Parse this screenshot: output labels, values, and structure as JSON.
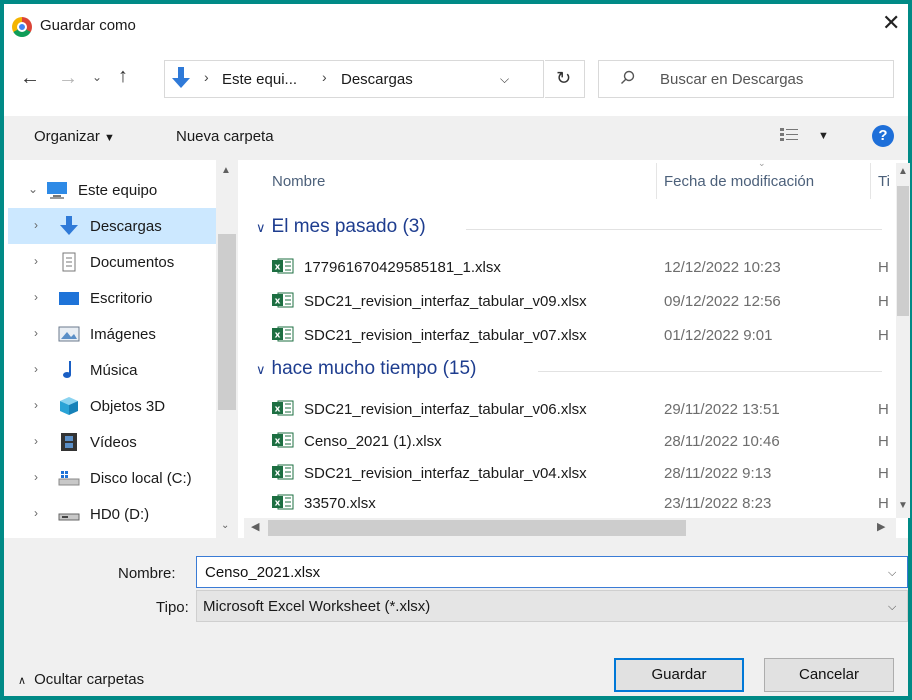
{
  "window": {
    "title": "Guardar como",
    "app_icon": "chrome-icon",
    "close_icon": "close-icon"
  },
  "address": {
    "crumbs": [
      "Este equi...",
      "Descargas"
    ],
    "search_placeholder": "Buscar en Descargas"
  },
  "toolbar": {
    "organize_label": "Organizar",
    "new_folder_label": "Nueva carpeta"
  },
  "nav": {
    "items": [
      {
        "label": "Este equipo",
        "icon": "computer-icon"
      },
      {
        "label": "Descargas",
        "icon": "download-arrow-icon"
      },
      {
        "label": "Documentos",
        "icon": "document-icon"
      },
      {
        "label": "Escritorio",
        "icon": "desktop-icon"
      },
      {
        "label": "Imágenes",
        "icon": "pictures-icon"
      },
      {
        "label": "Música",
        "icon": "music-note-icon"
      },
      {
        "label": "Objetos 3D",
        "icon": "cube-3d-icon"
      },
      {
        "label": "Vídeos",
        "icon": "film-icon"
      },
      {
        "label": "Disco local (C:)",
        "icon": "windows-drive-icon"
      },
      {
        "label": "HD0 (D:)",
        "icon": "drive-icon"
      }
    ]
  },
  "list": {
    "columns": {
      "name": "Nombre",
      "date": "Fecha de modificación",
      "type": "Ti"
    },
    "groups": [
      {
        "title": "El mes pasado (3)",
        "files": [
          {
            "name": "177961670429585181_1.xlsx",
            "date": "12/12/2022 10:23",
            "type": "H"
          },
          {
            "name": "SDC21_revision_interfaz_tabular_v09.xlsx",
            "date": "09/12/2022 12:56",
            "type": "H"
          },
          {
            "name": "SDC21_revision_interfaz_tabular_v07.xlsx",
            "date": "01/12/2022 9:01",
            "type": "H"
          }
        ]
      },
      {
        "title": "hace mucho tiempo (15)",
        "files": [
          {
            "name": "SDC21_revision_interfaz_tabular_v06.xlsx",
            "date": "29/11/2022 13:51",
            "type": "H"
          },
          {
            "name": "Censo_2021 (1).xlsx",
            "date": "28/11/2022 10:46",
            "type": "H"
          },
          {
            "name": "SDC21_revision_interfaz_tabular_v04.xlsx",
            "date": "28/11/2022 9:13",
            "type": "H"
          },
          {
            "name": "33570.xlsx",
            "date": "23/11/2022 8:23",
            "type": "H"
          }
        ]
      }
    ]
  },
  "form": {
    "name_label": "Nombre:",
    "name_value": "Censo_2021.xlsx",
    "type_label": "Tipo:",
    "type_value": "Microsoft Excel Worksheet (*.xlsx)"
  },
  "footer": {
    "hide_folders_label": "Ocultar carpetas",
    "save_label": "Guardar",
    "cancel_label": "Cancelar"
  },
  "colors": {
    "border": "#008a86",
    "selection": "#cce8ff",
    "group_header": "#1e3d8f",
    "excel_green": "#1d6f42",
    "accent_blue": "#0078d7"
  }
}
